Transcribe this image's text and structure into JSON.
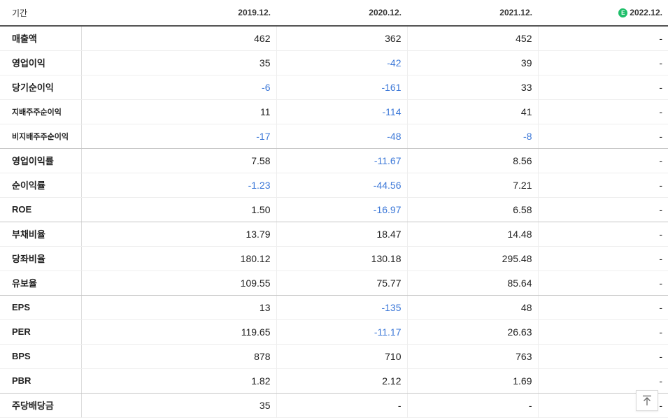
{
  "header": {
    "label": "기간",
    "periods": [
      "2019.12.",
      "2020.12.",
      "2021.12.",
      "2022.12."
    ],
    "estimate_badge": "E"
  },
  "rows": [
    {
      "label": "매출액",
      "values": [
        "462",
        "362",
        "452",
        "-"
      ]
    },
    {
      "label": "영업이익",
      "values": [
        "35",
        "-42",
        "39",
        "-"
      ]
    },
    {
      "label": "당기순이익",
      "values": [
        "-6",
        "-161",
        "33",
        "-"
      ]
    },
    {
      "label": "지배주주순이익",
      "values": [
        "11",
        "-114",
        "41",
        "-"
      ]
    },
    {
      "label": "비지배주주순이익",
      "values": [
        "-17",
        "-48",
        "-8",
        "-"
      ]
    },
    {
      "label": "영업이익률",
      "values": [
        "7.58",
        "-11.67",
        "8.56",
        "-"
      ]
    },
    {
      "label": "순이익률",
      "values": [
        "-1.23",
        "-44.56",
        "7.21",
        "-"
      ]
    },
    {
      "label": "ROE",
      "values": [
        "1.50",
        "-16.97",
        "6.58",
        "-"
      ]
    },
    {
      "label": "부채비율",
      "values": [
        "13.79",
        "18.47",
        "14.48",
        "-"
      ]
    },
    {
      "label": "당좌비율",
      "values": [
        "180.12",
        "130.18",
        "295.48",
        "-"
      ]
    },
    {
      "label": "유보율",
      "values": [
        "109.55",
        "75.77",
        "85.64",
        "-"
      ]
    },
    {
      "label": "EPS",
      "values": [
        "13",
        "-135",
        "48",
        "-"
      ]
    },
    {
      "label": "PER",
      "values": [
        "119.65",
        "-11.17",
        "26.63",
        "-"
      ]
    },
    {
      "label": "BPS",
      "values": [
        "878",
        "710",
        "763",
        "-"
      ]
    },
    {
      "label": "PBR",
      "values": [
        "1.82",
        "2.12",
        "1.69",
        "-"
      ]
    },
    {
      "label": "주당배당금",
      "values": [
        "35",
        "-",
        "-",
        "-"
      ]
    }
  ],
  "colors": {
    "negative": "#3c78d8",
    "estimate_badge": "#1fbf6a"
  },
  "scroll_top_button": {
    "icon": "arrow-up-to-top-icon"
  }
}
